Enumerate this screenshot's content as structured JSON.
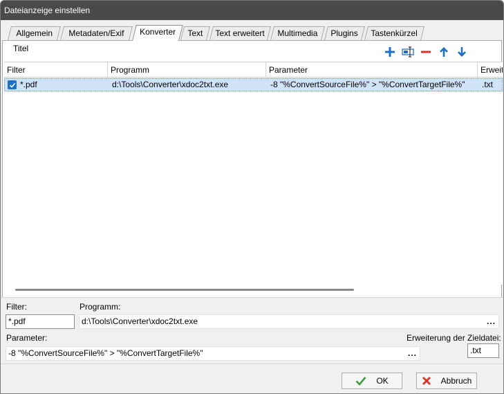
{
  "window": {
    "title": "Dateianzeige einstellen"
  },
  "tabs": [
    {
      "label": "Allgemein"
    },
    {
      "label": "Metadaten/Exif"
    },
    {
      "label": "Konverter"
    },
    {
      "label": "Text"
    },
    {
      "label": "Text erweitert"
    },
    {
      "label": "Multimedia"
    },
    {
      "label": "Plugins"
    },
    {
      "label": "Tastenkürzel"
    }
  ],
  "active_tab": "Konverter",
  "section": {
    "title": "Titel"
  },
  "toolbar": {
    "icons": [
      "add-icon",
      "edit-icon",
      "remove-icon",
      "move-up-icon",
      "move-down-icon"
    ],
    "colors": {
      "blue": "#1f6fc5",
      "red": "#d9332b"
    }
  },
  "grid": {
    "columns": [
      "Filter",
      "Programm",
      "Parameter",
      "Erweit"
    ],
    "rows": [
      {
        "checked": true,
        "filter": "*.pdf",
        "program": "d:\\Tools\\Converter\\xdoc2txt.exe",
        "parameter": "-8 \"%ConvertSourceFile%\" > \"%ConvertTargetFile%\"",
        "extension": ".txt"
      }
    ],
    "selection_color": "#cfe4f7"
  },
  "form": {
    "filter_label": "Filter:",
    "filter_value": "*.pdf",
    "program_label": "Programm:",
    "program_value": "d:\\Tools\\Converter\\xdoc2txt.exe",
    "program_browse": "...",
    "parameter_label": "Parameter:",
    "parameter_value": "-8 \"%ConvertSourceFile%\" > \"%ConvertTargetFile%\"",
    "parameter_browse": "...",
    "extension_label": "Erweiterung der Zieldatei:",
    "extension_value": ".txt"
  },
  "buttons": {
    "ok": "OK",
    "cancel": "Abbruch"
  }
}
